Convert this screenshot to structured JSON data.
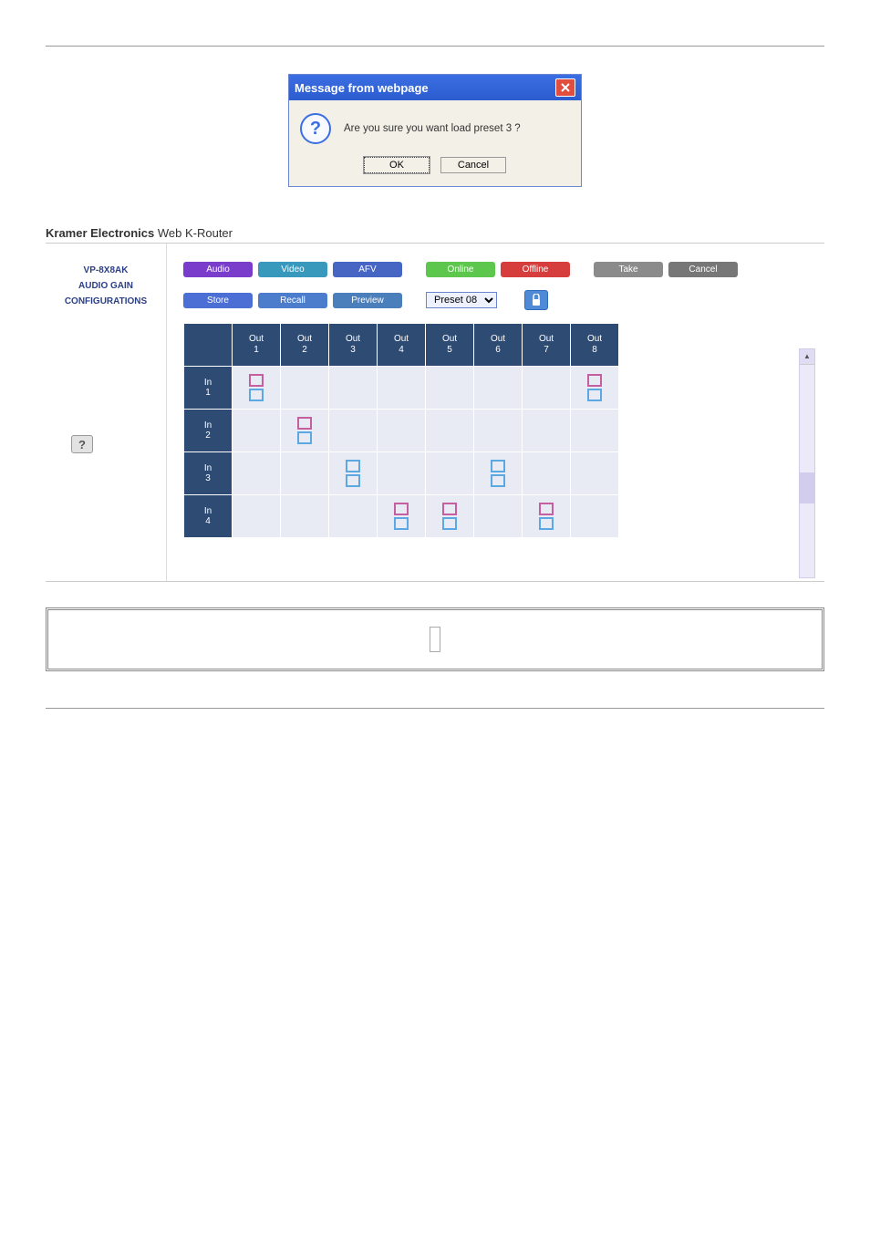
{
  "dialog": {
    "title": "Message from webpage",
    "close": "X",
    "message": "Are you sure you want load preset 3 ?",
    "ok": "OK",
    "cancel": "Cancel"
  },
  "router": {
    "brand": "Kramer Electronics",
    "product": "Web K-Router",
    "sidebar": {
      "items": [
        "VP-8X8AK",
        "AUDIO GAIN",
        "CONFIGURATIONS"
      ],
      "help": "?"
    },
    "buttons": {
      "audio": "Audio",
      "video": "Video",
      "afv": "AFV",
      "online": "Online",
      "offline": "Offline",
      "take": "Take",
      "cancel": "Cancel",
      "store": "Store",
      "recall": "Recall",
      "preview": "Preview",
      "preset": "Preset 08"
    },
    "matrix": {
      "cols": [
        "Out\n1",
        "Out\n2",
        "Out\n3",
        "Out\n4",
        "Out\n5",
        "Out\n6",
        "Out\n7",
        "Out\n8"
      ],
      "rows": [
        "In\n1",
        "In\n2",
        "In\n3",
        "In\n4"
      ],
      "cells": [
        [
          {
            "k": "mix"
          },
          null,
          null,
          null,
          null,
          null,
          null,
          {
            "k": "mix"
          }
        ],
        [
          null,
          {
            "k": "mix"
          },
          null,
          null,
          null,
          null,
          null,
          null
        ],
        [
          null,
          null,
          {
            "k": "blue"
          },
          null,
          null,
          {
            "k": "blue"
          },
          null,
          null
        ],
        [
          null,
          null,
          null,
          {
            "k": "mix"
          },
          {
            "k": "mix"
          },
          null,
          {
            "k": "mix"
          },
          null
        ]
      ]
    }
  }
}
